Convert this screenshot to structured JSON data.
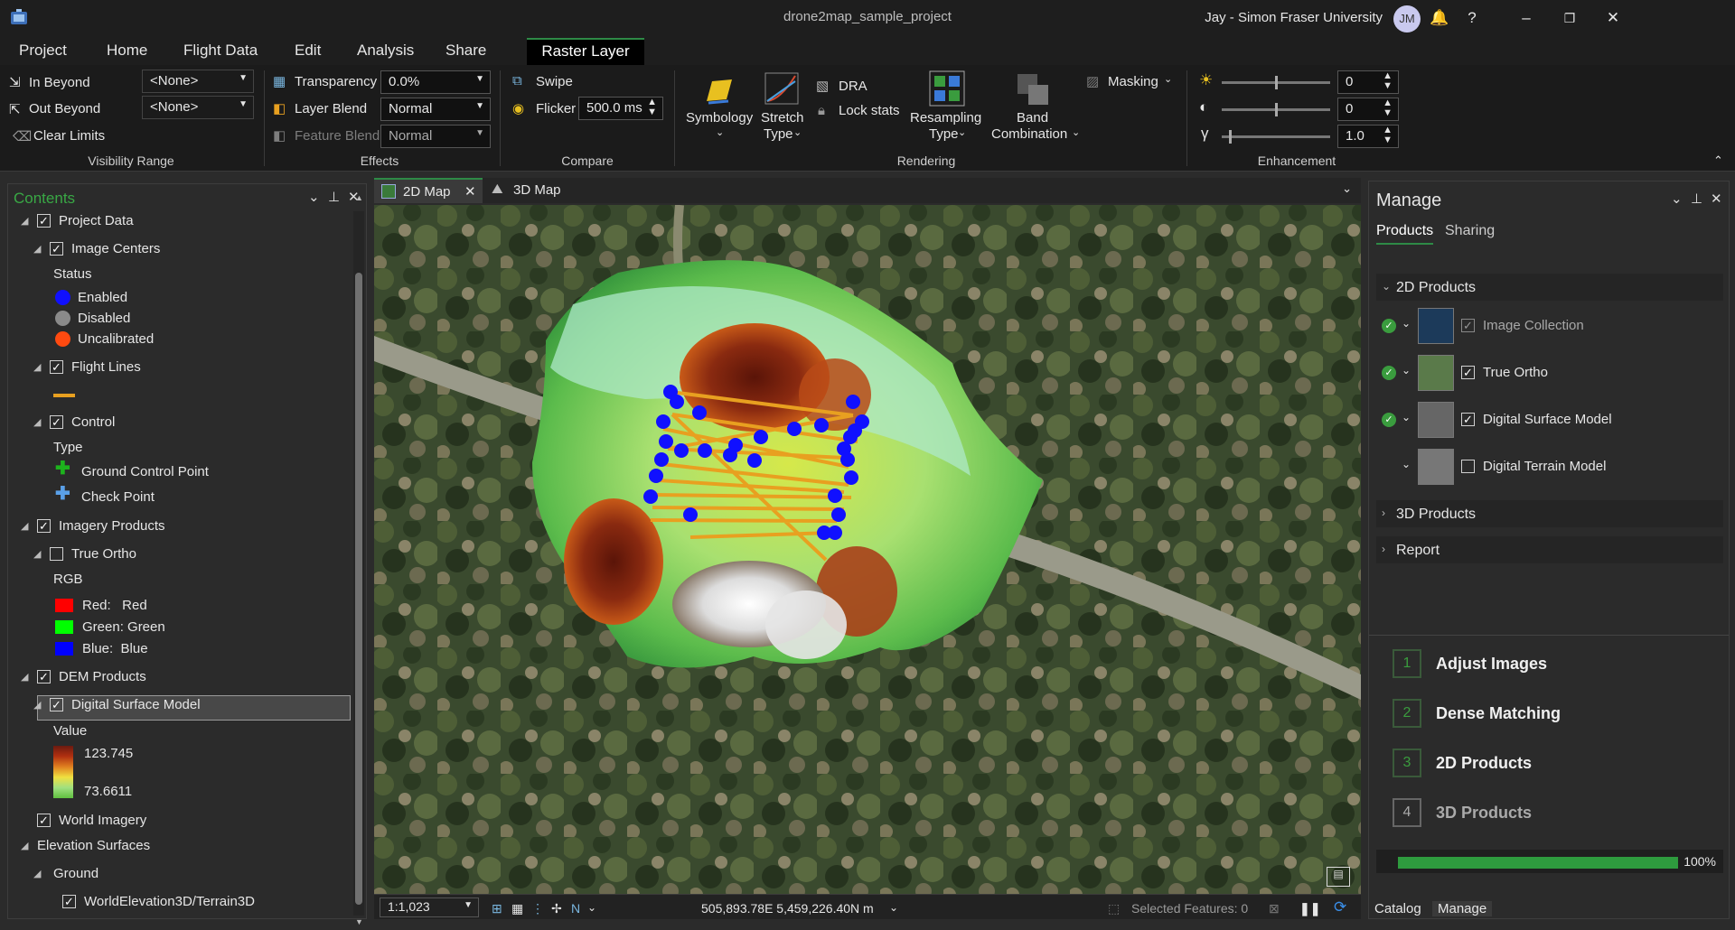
{
  "window": {
    "title": "drone2map_sample_project",
    "user": "Jay - Simon Fraser University",
    "avatar_initials": "JM"
  },
  "menu": {
    "tabs": [
      "Project",
      "Home",
      "Flight Data",
      "Edit",
      "Analysis",
      "Share"
    ],
    "active_tab": "Raster Layer"
  },
  "ribbon": {
    "visibility": {
      "in_beyond": "In Beyond",
      "out_beyond": "Out Beyond",
      "clear_limits": "Clear Limits",
      "in_value": "<None>",
      "out_value": "<None>",
      "label": "Visibility Range"
    },
    "effects": {
      "transparency_label": "Transparency",
      "transparency_value": "0.0%",
      "layer_blend_label": "Layer Blend",
      "layer_blend_value": "Normal",
      "feature_blend_label": "Feature Blend",
      "feature_blend_value": "Normal",
      "label": "Effects"
    },
    "compare": {
      "swipe": "Swipe",
      "flicker": "Flicker",
      "flicker_value": "500.0",
      "flicker_unit": "ms",
      "label": "Compare"
    },
    "rendering": {
      "symbology": "Symbology",
      "stretch_type_1": "Stretch",
      "stretch_type_2": "Type",
      "dra": "DRA",
      "lock_stats": "Lock stats",
      "resampling_1": "Resampling",
      "resampling_2": "Type",
      "band_1": "Band",
      "band_2": "Combination",
      "masking": "Masking",
      "label": "Rendering"
    },
    "enhancement": {
      "brightness": "0",
      "contrast": "0",
      "gamma": "1.0",
      "gamma_symbol": "γ",
      "label": "Enhancement"
    }
  },
  "contents": {
    "title": "Contents",
    "project_data": "Project Data",
    "image_centers": "Image Centers",
    "status": "Status",
    "enabled": "Enabled",
    "disabled": "Disabled",
    "uncalibrated": "Uncalibrated",
    "flight_lines": "Flight Lines",
    "control": "Control",
    "type": "Type",
    "gcp": "Ground Control Point",
    "check_point": "Check Point",
    "imagery_products": "Imagery Products",
    "true_ortho": "True Ortho",
    "rgb": "RGB",
    "red": "Red:   Red",
    "green": "Green: Green",
    "blue": "Blue:  Blue",
    "dem_products": "DEM Products",
    "dsm": "Digital Surface Model",
    "value": "Value",
    "value_max": "123.745",
    "value_min": "73.6611",
    "world_imagery": "World Imagery",
    "elevation_surfaces": "Elevation Surfaces",
    "ground": "Ground",
    "world_elevation": "WorldElevation3D/Terrain3D"
  },
  "map": {
    "tab_2d": "2D Map",
    "tab_3d": "3D Map",
    "scale": "1:1,023",
    "coords": "505,893.78E 5,459,226.40N m",
    "selected_features": "Selected Features: 0"
  },
  "manage": {
    "title": "Manage",
    "tab_products": "Products",
    "tab_sharing": "Sharing",
    "section_2d": "2D Products",
    "image_collection": "Image Collection",
    "true_ortho": "True Ortho",
    "dsm": "Digital Surface Model",
    "dtm": "Digital Terrain Model",
    "section_3d": "3D Products",
    "section_report": "Report",
    "steps": [
      {
        "num": "1",
        "label": "Adjust Images"
      },
      {
        "num": "2",
        "label": "Dense Matching"
      },
      {
        "num": "3",
        "label": "2D Products"
      },
      {
        "num": "4",
        "label": "3D Products"
      }
    ],
    "progress": 1.0,
    "progress_label": "100%",
    "bottom_catalog": "Catalog",
    "bottom_manage": "Manage"
  },
  "colors": {
    "accent_green": "#2e8a46",
    "enabled": "#1010ff",
    "disabled": "#8a8a8a",
    "uncalibrated": "#ff4a10",
    "flight_line": "#e8a020",
    "gcp": "#1db31d",
    "check_point": "#5aa0e8"
  }
}
